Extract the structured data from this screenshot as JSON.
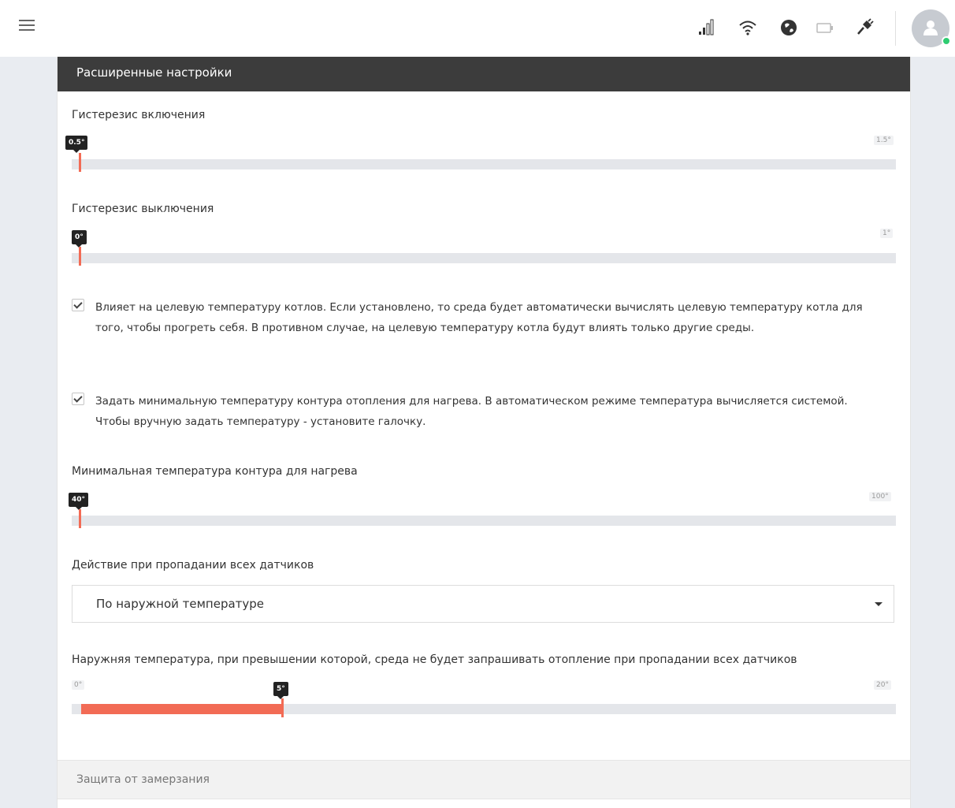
{
  "panel": {
    "title": "Расширенные настройки"
  },
  "sliders": {
    "on_hysteresis": {
      "label": "Гистерезис включения",
      "value": "0.5°",
      "max": "1.5°",
      "fraction": 0.0
    },
    "off_hysteresis": {
      "label": "Гистерезис выключения",
      "value": "0°",
      "max": "1°",
      "fraction": 0.0
    },
    "min_circuit_temp": {
      "label": "Минимальная температура контура для нагрева",
      "value": "40°",
      "max": "100°",
      "fraction": 0.0
    },
    "outdoor_temp": {
      "label": "Наружняя температура, при превышении которой, среда не будет запрашивать отопление при пропадании всех датчиков",
      "value": "5°",
      "min": "0°",
      "max": "20°",
      "fraction": 0.25
    }
  },
  "checkboxes": {
    "affect_target": {
      "checked": true,
      "text": "Влияет на целевую температуру котлов. Если установлено, то среда будет автоматически вычислять целевую температуру котла для того, чтобы прогреть себя. В противном случае, на целевую температуру котла будут влиять только другие среды."
    },
    "set_min_temp": {
      "checked": true,
      "text": "Задать минимальную температуру контура отопления для нагрева. В автоматическом режиме температура вычисляется системой. Чтобы вручную задать температуру - установите галочку."
    }
  },
  "sensor_loss": {
    "label": "Действие при пропадании всех датчиков",
    "selected": "По наружной температуре"
  },
  "freeze_section": {
    "title": "Защита от замерзания"
  },
  "colors": {
    "accent": "#f26b55",
    "header_bg": "#3c3c3c",
    "page_bg": "#e9ecf1"
  },
  "icons": [
    "menu-icon",
    "signal-icon",
    "wifi-icon",
    "globe-icon",
    "battery-icon",
    "plug-icon",
    "user-icon"
  ]
}
